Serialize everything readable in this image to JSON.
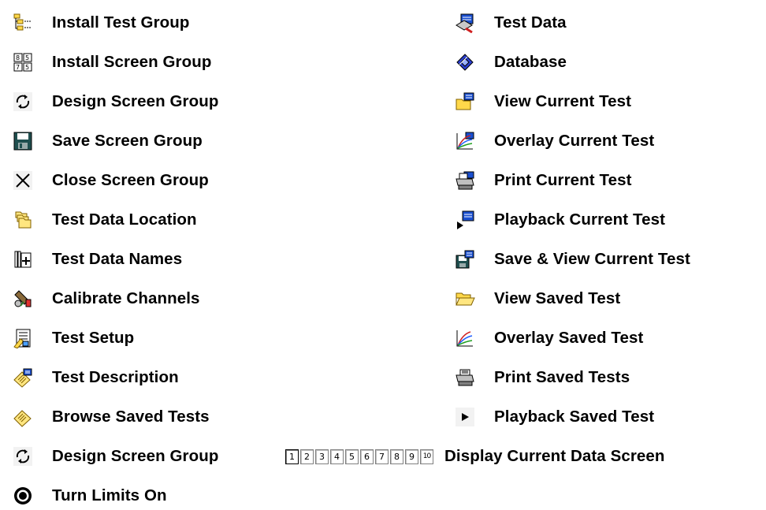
{
  "left_items": [
    {
      "icon": "install-test-group-icon",
      "label": "Install Test Group"
    },
    {
      "icon": "install-screen-group-icon",
      "label": "Install Screen Group"
    },
    {
      "icon": "design-screen-group-icon",
      "label": "Design Screen Group"
    },
    {
      "icon": "save-disk-icon",
      "label": "Save Screen Group"
    },
    {
      "icon": "close-x-icon",
      "label": "Close Screen Group"
    },
    {
      "icon": "folders-icon",
      "label": "Test Data Location"
    },
    {
      "icon": "data-names-icon",
      "label": "Test Data Names"
    },
    {
      "icon": "calibrate-channels-icon",
      "label": "Calibrate Channels"
    },
    {
      "icon": "test-setup-icon",
      "label": "Test Setup"
    },
    {
      "icon": "test-description-icon",
      "label": "Test Description"
    },
    {
      "icon": "browse-saved-tests-icon",
      "label": "Browse Saved Tests"
    },
    {
      "icon": "design-screen-group-icon",
      "label": "Design Screen Group"
    },
    {
      "icon": "limits-on-icon",
      "label": "Turn Limits On"
    }
  ],
  "right_items": [
    {
      "icon": "test-data-icon",
      "label": "Test Data"
    },
    {
      "icon": "database-icon",
      "label": "Database"
    },
    {
      "icon": "view-current-test-icon",
      "label": "View Current Test"
    },
    {
      "icon": "overlay-current-test-icon",
      "label": "Overlay Current Test"
    },
    {
      "icon": "print-current-test-icon",
      "label": "Print Current Test"
    },
    {
      "icon": "playback-current-test-icon",
      "label": "Playback Current Test"
    },
    {
      "icon": "save-view-current-test-icon",
      "label": "Save & View Current Test"
    },
    {
      "icon": "open-folder-icon",
      "label": "View Saved Test"
    },
    {
      "icon": "overlay-saved-test-icon",
      "label": "Overlay Saved Test"
    },
    {
      "icon": "printer-icon",
      "label": "Print Saved Tests"
    },
    {
      "icon": "play-icon",
      "label": "Playback Saved Test"
    }
  ],
  "screen_numbers": [
    "1",
    "2",
    "3",
    "4",
    "5",
    "6",
    "7",
    "8",
    "9",
    "10"
  ],
  "display_current_label": "Display Current Data Screen"
}
